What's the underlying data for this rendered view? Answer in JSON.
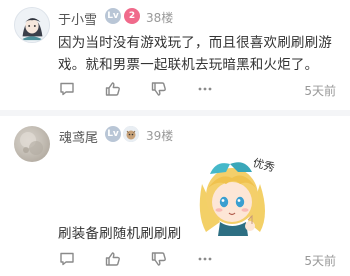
{
  "comments": [
    {
      "username": "于小雪",
      "badges": [
        "Lv",
        "2"
      ],
      "floor": "38楼",
      "lines": [
        "因为当时没有游戏玩了，而且很喜欢刷刷刷游",
        "戏。就和男票一起联机去玩暗黑和火炬了。"
      ],
      "time": "5天前",
      "icons": [
        "comment-icon",
        "like-icon",
        "dislike-icon",
        "more-icon"
      ]
    },
    {
      "username": "魂鸢尾",
      "badges": [
        "Lv",
        "pet"
      ],
      "floor": "39楼",
      "sticker_text": "优秀",
      "lines": [
        "刷装备刷随机刷刷刷"
      ],
      "time": "5天前",
      "icons": [
        "comment-icon",
        "like-icon",
        "dislike-icon",
        "more-icon"
      ]
    }
  ],
  "colors": {
    "text": "#333333",
    "meta": "#999999",
    "username": "#555555",
    "accent_pink": "#f06a8b",
    "divider": "#f4f5f7"
  }
}
